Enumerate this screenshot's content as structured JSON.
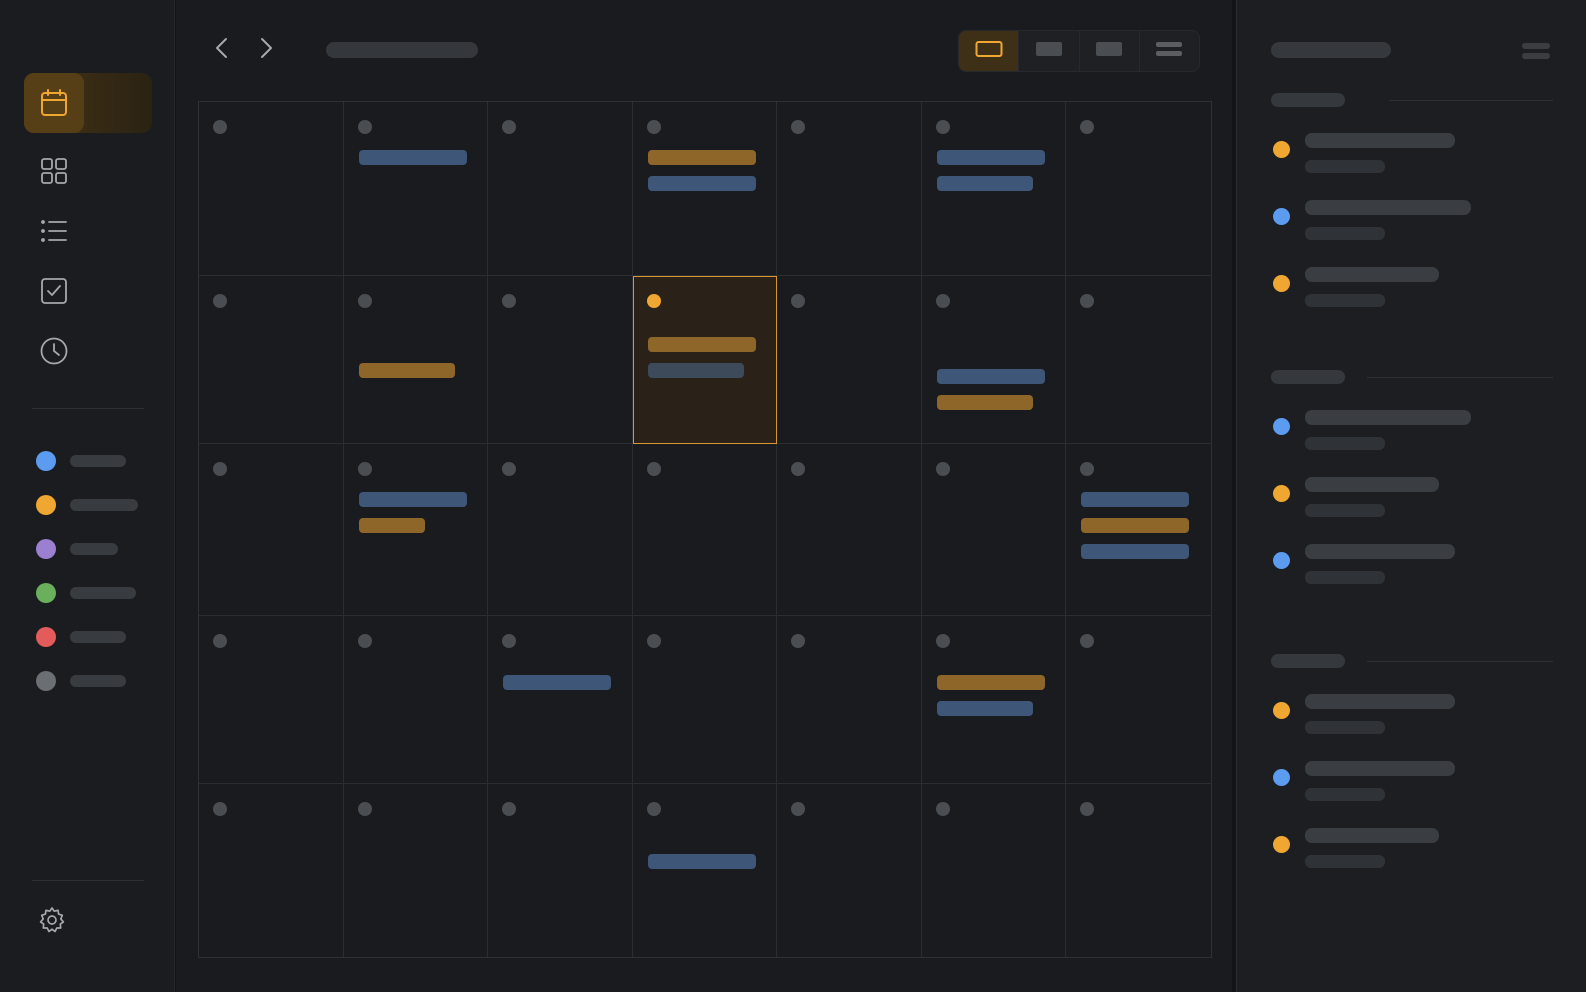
{
  "colors": {
    "accent": "#f0a732",
    "blue": "#5b9bf0",
    "orange": "#f0a732",
    "purple": "#9b7fd0",
    "green": "#6aaf5c",
    "red": "#e45b5b",
    "gray": "#6b6e73"
  },
  "sidebar": {
    "nav": [
      {
        "icon": "calendar-icon",
        "active": true
      },
      {
        "icon": "grid-icon",
        "active": false
      },
      {
        "icon": "list-icon",
        "active": false
      },
      {
        "icon": "checkbox-icon",
        "active": false
      },
      {
        "icon": "clock-icon",
        "active": false
      }
    ],
    "categories": [
      {
        "color": "blue"
      },
      {
        "color": "orange"
      },
      {
        "color": "purple"
      },
      {
        "color": "green"
      },
      {
        "color": "red"
      },
      {
        "color": "gray"
      }
    ],
    "settings_icon": "gear-icon"
  },
  "toolbar": {
    "prev_icon": "chevron-left-icon",
    "next_icon": "chevron-right-icon",
    "views": [
      {
        "icon": "month-view-icon",
        "active": true
      },
      {
        "icon": "week-view-icon",
        "active": false
      },
      {
        "icon": "day-view-icon",
        "active": false
      },
      {
        "icon": "agenda-view-icon",
        "active": false
      }
    ]
  },
  "calendar": {
    "rows": 5,
    "cols": 7,
    "selected": {
      "row": 1,
      "col": 3
    },
    "events": [
      {
        "row": 0,
        "col": 1,
        "items": [
          "blue"
        ]
      },
      {
        "row": 0,
        "col": 3,
        "items": [
          "orange",
          "blue"
        ]
      },
      {
        "row": 0,
        "col": 5,
        "items": [
          "blue",
          "blue"
        ]
      },
      {
        "row": 1,
        "col": 1,
        "items": [
          "orange"
        ]
      },
      {
        "row": 1,
        "col": 3,
        "items": [
          "orange",
          "gray"
        ]
      },
      {
        "row": 1,
        "col": 5,
        "items": [
          "blue",
          "orange"
        ]
      },
      {
        "row": 2,
        "col": 1,
        "items": [
          "blue",
          "orange"
        ]
      },
      {
        "row": 2,
        "col": 6,
        "items": [
          "blue",
          "orange",
          "blue"
        ]
      },
      {
        "row": 3,
        "col": 2,
        "items": [
          "blue"
        ]
      },
      {
        "row": 3,
        "col": 5,
        "items": [
          "orange",
          "blue"
        ]
      },
      {
        "row": 4,
        "col": 3,
        "items": [
          "blue"
        ]
      }
    ]
  },
  "agenda": {
    "sections": [
      {
        "items": [
          "orange",
          "blue",
          "orange"
        ]
      },
      {
        "items": [
          "blue",
          "orange",
          "blue"
        ]
      },
      {
        "items": [
          "orange",
          "blue",
          "orange"
        ]
      }
    ]
  }
}
